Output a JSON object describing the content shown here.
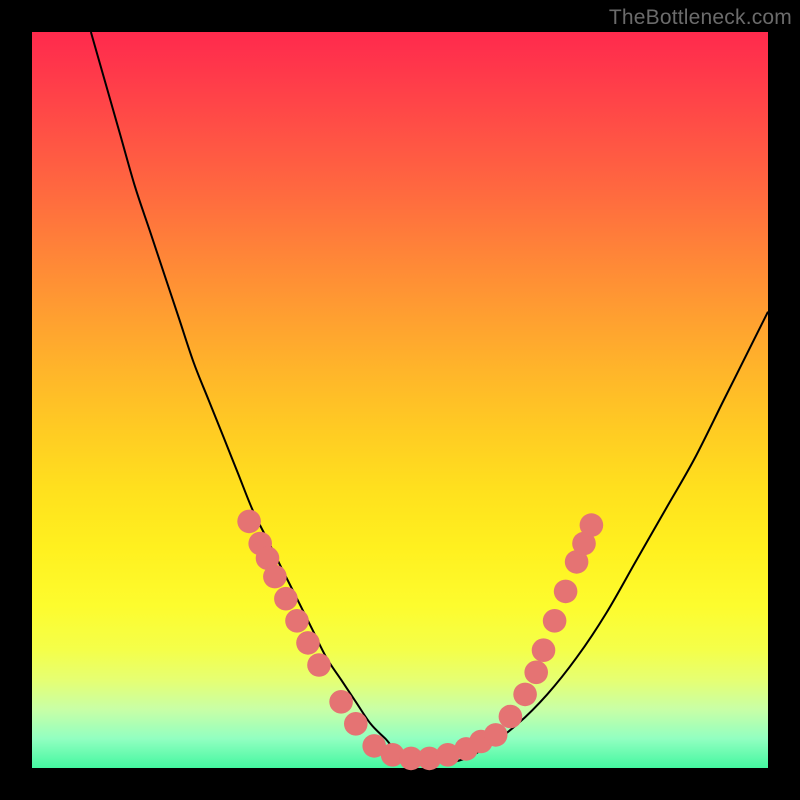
{
  "watermark": "TheBottleneck.com",
  "colors": {
    "frame": "#000000",
    "curve": "#000000",
    "marker": "#e57373",
    "gradient_top": "#ff2a4d",
    "gradient_bottom": "#44f7a0"
  },
  "chart_data": {
    "type": "line",
    "title": "",
    "xlabel": "",
    "ylabel": "",
    "xlim": [
      0,
      100
    ],
    "ylim": [
      0,
      100
    ],
    "series": [
      {
        "name": "curve",
        "x": [
          8,
          10,
          12,
          14,
          16,
          18,
          20,
          22,
          24,
          26,
          28,
          30,
          32,
          34,
          36,
          38,
          40,
          42,
          44,
          46,
          48,
          50,
          54,
          58,
          62,
          66,
          70,
          74,
          78,
          82,
          86,
          90,
          94,
          98,
          100
        ],
        "y": [
          100,
          93,
          86,
          79,
          73,
          67,
          61,
          55,
          50,
          45,
          40,
          35,
          31,
          27,
          23,
          19,
          15,
          12,
          9,
          6,
          4,
          2,
          1,
          1,
          3,
          6,
          10,
          15,
          21,
          28,
          35,
          42,
          50,
          58,
          62
        ]
      }
    ],
    "markers": {
      "left_branch": [
        {
          "x": 29.5,
          "y": 33.5
        },
        {
          "x": 31.0,
          "y": 30.5
        },
        {
          "x": 32.0,
          "y": 28.5
        },
        {
          "x": 33.0,
          "y": 26.0
        },
        {
          "x": 34.5,
          "y": 23.0
        },
        {
          "x": 36.0,
          "y": 20.0
        },
        {
          "x": 37.5,
          "y": 17.0
        },
        {
          "x": 39.0,
          "y": 14.0
        },
        {
          "x": 42.0,
          "y": 9.0
        },
        {
          "x": 44.0,
          "y": 6.0
        }
      ],
      "right_branch": [
        {
          "x": 63.0,
          "y": 4.5
        },
        {
          "x": 65.0,
          "y": 7.0
        },
        {
          "x": 67.0,
          "y": 10.0
        },
        {
          "x": 68.5,
          "y": 13.0
        },
        {
          "x": 69.5,
          "y": 16.0
        },
        {
          "x": 71.0,
          "y": 20.0
        },
        {
          "x": 72.5,
          "y": 24.0
        },
        {
          "x": 74.0,
          "y": 28.0
        },
        {
          "x": 75.0,
          "y": 30.5
        },
        {
          "x": 76.0,
          "y": 33.0
        }
      ],
      "trough": [
        {
          "x": 46.5,
          "y": 3.0
        },
        {
          "x": 49.0,
          "y": 1.8
        },
        {
          "x": 51.5,
          "y": 1.3
        },
        {
          "x": 54.0,
          "y": 1.3
        },
        {
          "x": 56.5,
          "y": 1.8
        },
        {
          "x": 59.0,
          "y": 2.6
        },
        {
          "x": 61.0,
          "y": 3.6
        }
      ]
    },
    "marker_radius_pct": 1.6
  }
}
